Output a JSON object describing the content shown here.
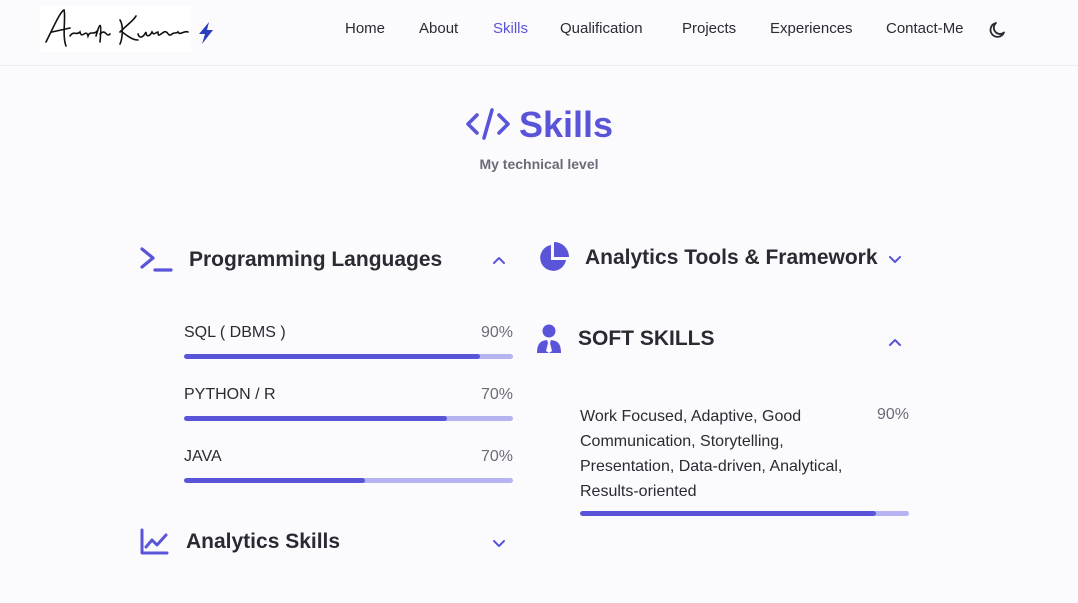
{
  "header": {
    "logo_text": "Akash Kumar",
    "nav": [
      {
        "label": "Home"
      },
      {
        "label": "About"
      },
      {
        "label": "Skills"
      },
      {
        "label": "Qualification"
      },
      {
        "label": "Projects"
      },
      {
        "label": "Experiences"
      },
      {
        "label": "Contact-Me"
      }
    ],
    "active_nav": "Skills",
    "theme_toggle_icon": "moon-icon"
  },
  "section": {
    "icon": "code-icon",
    "title": "Skills",
    "subtitle": "My technical level"
  },
  "groups": {
    "programming": {
      "title": "Programming Languages",
      "icon": "terminal-icon",
      "expanded": true,
      "skills": [
        {
          "name": "SQL ( DBMS )",
          "percent": "90%",
          "level": 0.9
        },
        {
          "name": "PYTHON / R",
          "percent": "70%",
          "level": 0.8
        },
        {
          "name": "JAVA",
          "percent": "70%",
          "level": 0.55
        }
      ]
    },
    "analytics_skills": {
      "title": "Analytics Skills",
      "icon": "line-chart-icon",
      "expanded": false
    },
    "tools": {
      "title": "Analytics Tools & Framework",
      "icon": "pie-chart-icon",
      "expanded": false
    },
    "soft": {
      "title": "SOFT SKILLS",
      "icon": "user-tie-icon",
      "expanded": true,
      "skills": [
        {
          "name": "Work Focused, Adaptive, Good Communication, Storytelling, Presentation, Data-driven, Analytical, Results-oriented",
          "percent": "90%",
          "level": 0.9
        }
      ]
    }
  },
  "colors": {
    "accent": "#5a55d8",
    "accent_light": "#b6b3f3",
    "background": "#fbfbfe",
    "text": "#2b2a33"
  }
}
